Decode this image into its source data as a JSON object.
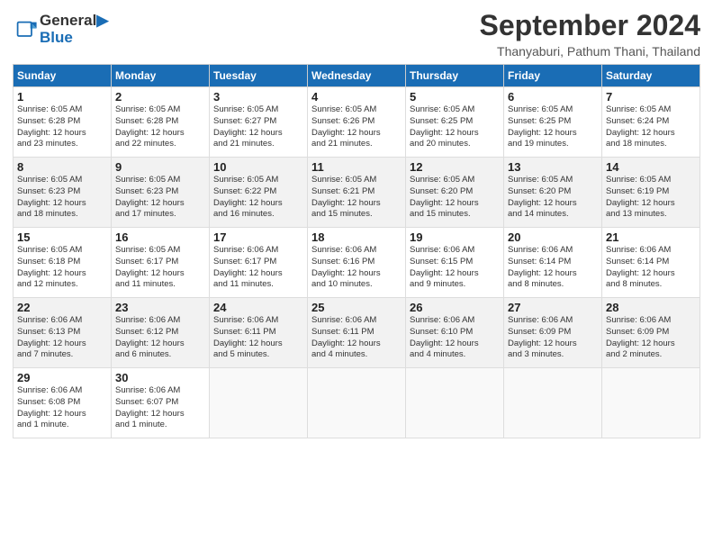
{
  "header": {
    "logo_line1": "General",
    "logo_line2": "Blue",
    "month": "September 2024",
    "location": "Thanyaburi, Pathum Thani, Thailand"
  },
  "weekdays": [
    "Sunday",
    "Monday",
    "Tuesday",
    "Wednesday",
    "Thursday",
    "Friday",
    "Saturday"
  ],
  "weeks": [
    [
      {
        "day": "1",
        "info": "Sunrise: 6:05 AM\nSunset: 6:28 PM\nDaylight: 12 hours\nand 23 minutes."
      },
      {
        "day": "2",
        "info": "Sunrise: 6:05 AM\nSunset: 6:28 PM\nDaylight: 12 hours\nand 22 minutes."
      },
      {
        "day": "3",
        "info": "Sunrise: 6:05 AM\nSunset: 6:27 PM\nDaylight: 12 hours\nand 21 minutes."
      },
      {
        "day": "4",
        "info": "Sunrise: 6:05 AM\nSunset: 6:26 PM\nDaylight: 12 hours\nand 21 minutes."
      },
      {
        "day": "5",
        "info": "Sunrise: 6:05 AM\nSunset: 6:25 PM\nDaylight: 12 hours\nand 20 minutes."
      },
      {
        "day": "6",
        "info": "Sunrise: 6:05 AM\nSunset: 6:25 PM\nDaylight: 12 hours\nand 19 minutes."
      },
      {
        "day": "7",
        "info": "Sunrise: 6:05 AM\nSunset: 6:24 PM\nDaylight: 12 hours\nand 18 minutes."
      }
    ],
    [
      {
        "day": "8",
        "info": "Sunrise: 6:05 AM\nSunset: 6:23 PM\nDaylight: 12 hours\nand 18 minutes."
      },
      {
        "day": "9",
        "info": "Sunrise: 6:05 AM\nSunset: 6:23 PM\nDaylight: 12 hours\nand 17 minutes."
      },
      {
        "day": "10",
        "info": "Sunrise: 6:05 AM\nSunset: 6:22 PM\nDaylight: 12 hours\nand 16 minutes."
      },
      {
        "day": "11",
        "info": "Sunrise: 6:05 AM\nSunset: 6:21 PM\nDaylight: 12 hours\nand 15 minutes."
      },
      {
        "day": "12",
        "info": "Sunrise: 6:05 AM\nSunset: 6:20 PM\nDaylight: 12 hours\nand 15 minutes."
      },
      {
        "day": "13",
        "info": "Sunrise: 6:05 AM\nSunset: 6:20 PM\nDaylight: 12 hours\nand 14 minutes."
      },
      {
        "day": "14",
        "info": "Sunrise: 6:05 AM\nSunset: 6:19 PM\nDaylight: 12 hours\nand 13 minutes."
      }
    ],
    [
      {
        "day": "15",
        "info": "Sunrise: 6:05 AM\nSunset: 6:18 PM\nDaylight: 12 hours\nand 12 minutes."
      },
      {
        "day": "16",
        "info": "Sunrise: 6:05 AM\nSunset: 6:17 PM\nDaylight: 12 hours\nand 11 minutes."
      },
      {
        "day": "17",
        "info": "Sunrise: 6:06 AM\nSunset: 6:17 PM\nDaylight: 12 hours\nand 11 minutes."
      },
      {
        "day": "18",
        "info": "Sunrise: 6:06 AM\nSunset: 6:16 PM\nDaylight: 12 hours\nand 10 minutes."
      },
      {
        "day": "19",
        "info": "Sunrise: 6:06 AM\nSunset: 6:15 PM\nDaylight: 12 hours\nand 9 minutes."
      },
      {
        "day": "20",
        "info": "Sunrise: 6:06 AM\nSunset: 6:14 PM\nDaylight: 12 hours\nand 8 minutes."
      },
      {
        "day": "21",
        "info": "Sunrise: 6:06 AM\nSunset: 6:14 PM\nDaylight: 12 hours\nand 8 minutes."
      }
    ],
    [
      {
        "day": "22",
        "info": "Sunrise: 6:06 AM\nSunset: 6:13 PM\nDaylight: 12 hours\nand 7 minutes."
      },
      {
        "day": "23",
        "info": "Sunrise: 6:06 AM\nSunset: 6:12 PM\nDaylight: 12 hours\nand 6 minutes."
      },
      {
        "day": "24",
        "info": "Sunrise: 6:06 AM\nSunset: 6:11 PM\nDaylight: 12 hours\nand 5 minutes."
      },
      {
        "day": "25",
        "info": "Sunrise: 6:06 AM\nSunset: 6:11 PM\nDaylight: 12 hours\nand 4 minutes."
      },
      {
        "day": "26",
        "info": "Sunrise: 6:06 AM\nSunset: 6:10 PM\nDaylight: 12 hours\nand 4 minutes."
      },
      {
        "day": "27",
        "info": "Sunrise: 6:06 AM\nSunset: 6:09 PM\nDaylight: 12 hours\nand 3 minutes."
      },
      {
        "day": "28",
        "info": "Sunrise: 6:06 AM\nSunset: 6:09 PM\nDaylight: 12 hours\nand 2 minutes."
      }
    ],
    [
      {
        "day": "29",
        "info": "Sunrise: 6:06 AM\nSunset: 6:08 PM\nDaylight: 12 hours\nand 1 minute."
      },
      {
        "day": "30",
        "info": "Sunrise: 6:06 AM\nSunset: 6:07 PM\nDaylight: 12 hours\nand 1 minute."
      },
      {
        "day": "",
        "info": ""
      },
      {
        "day": "",
        "info": ""
      },
      {
        "day": "",
        "info": ""
      },
      {
        "day": "",
        "info": ""
      },
      {
        "day": "",
        "info": ""
      }
    ]
  ]
}
